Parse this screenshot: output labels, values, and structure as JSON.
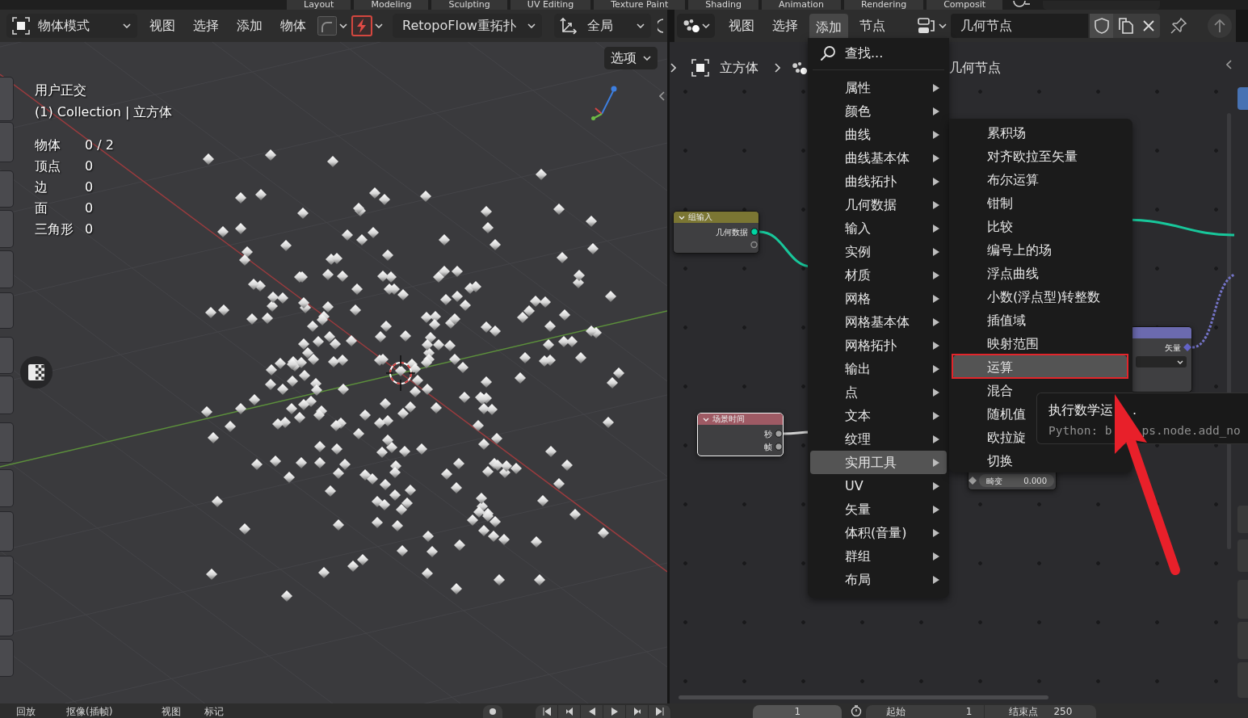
{
  "workspace_tabs": [
    {
      "label": "Layout",
      "selected": false
    },
    {
      "label": "Modeling",
      "selected": false
    },
    {
      "label": "Sculpting",
      "selected": false
    },
    {
      "label": "UV Editing",
      "selected": false
    },
    {
      "label": "Texture Paint",
      "selected": false
    },
    {
      "label": "Shading",
      "selected": false
    },
    {
      "label": "Animation",
      "selected": false
    },
    {
      "label": "Rendering",
      "selected": false
    },
    {
      "label": "Composit",
      "selected": false
    }
  ],
  "viewport": {
    "header": {
      "mode": "物体模式",
      "menus": [
        "视图",
        "选择",
        "添加",
        "物体"
      ],
      "retopo_menu": "RetopoFlow重拓扑",
      "orientation": "全局"
    },
    "options_button": "选项",
    "view_name": "用户正交",
    "collection_info": "(1) Collection | 立方体",
    "stats": [
      {
        "label": "物体",
        "value": "0 / 2"
      },
      {
        "label": "顶点",
        "value": "0"
      },
      {
        "label": "边",
        "value": "0"
      },
      {
        "label": "面",
        "value": "0"
      },
      {
        "label": "三角形",
        "value": "0"
      }
    ]
  },
  "node_editor": {
    "header": {
      "menus": [
        {
          "label": "视图",
          "selected": false
        },
        {
          "label": "选择",
          "selected": false
        },
        {
          "label": "添加",
          "selected": true
        },
        {
          "label": "节点",
          "selected": false
        }
      ],
      "node_group": "几何节点"
    },
    "breadcrumbs": [
      "立方体",
      "几何节点"
    ],
    "nodes": [
      {
        "kind": "group_input",
        "title": "组输入",
        "color": "#7b7633",
        "selected": false,
        "outputs": [
          "几何数据"
        ]
      },
      {
        "kind": "scene_time",
        "title": "场景时间",
        "color": "#9e5a64",
        "selected": true,
        "outputs": [
          "秒",
          "帧"
        ]
      },
      {
        "kind": "vector_node",
        "color": "#6b6aaf",
        "selected": false,
        "outputs": [
          "矢量"
        ]
      },
      {
        "kind": "field_row",
        "label": "畸变",
        "value": "0.000"
      }
    ],
    "sidebar_tabs": [
      {
        "selected": true
      },
      {
        "selected": false
      },
      {
        "selected": false
      },
      {
        "selected": false
      },
      {
        "selected": false
      },
      {
        "selected": false
      }
    ]
  },
  "add_menu": {
    "search": "查找...",
    "items": [
      {
        "label": "属性",
        "selected": false
      },
      {
        "label": "颜色",
        "selected": false
      },
      {
        "label": "曲线",
        "selected": false
      },
      {
        "label": "曲线基本体",
        "selected": false
      },
      {
        "label": "曲线拓扑",
        "selected": false
      },
      {
        "label": "几何数据",
        "selected": false
      },
      {
        "label": "输入",
        "selected": false
      },
      {
        "label": "实例",
        "selected": false
      },
      {
        "label": "材质",
        "selected": false
      },
      {
        "label": "网格",
        "selected": false
      },
      {
        "label": "网格基本体",
        "selected": false
      },
      {
        "label": "网格拓扑",
        "selected": false
      },
      {
        "label": "输出",
        "selected": false
      },
      {
        "label": "点",
        "selected": false
      },
      {
        "label": "文本",
        "selected": false
      },
      {
        "label": "纹理",
        "selected": false
      },
      {
        "label": "实用工具",
        "selected": true
      },
      {
        "label": "UV",
        "selected": false
      },
      {
        "label": "矢量",
        "selected": false
      },
      {
        "label": "体积(音量)",
        "selected": false
      },
      {
        "label": "群组",
        "selected": false
      },
      {
        "label": "布局",
        "selected": false
      }
    ]
  },
  "utilities_submenu": {
    "items": [
      {
        "label": "累积场",
        "selected": false
      },
      {
        "label": "对齐欧拉至矢量",
        "selected": false
      },
      {
        "label": "布尔运算",
        "selected": false
      },
      {
        "label": "钳制",
        "selected": false
      },
      {
        "label": "比较",
        "selected": false
      },
      {
        "label": "编号上的场",
        "selected": false
      },
      {
        "label": "浮点曲线",
        "selected": false
      },
      {
        "label": "小数(浮点型)转整数",
        "selected": false
      },
      {
        "label": "插值域",
        "selected": false
      },
      {
        "label": "映射范围",
        "selected": false
      },
      {
        "label": "运算",
        "selected": true
      },
      {
        "label": "混合",
        "selected": false
      },
      {
        "label": "随机值",
        "selected": false
      },
      {
        "label": "欧拉旋",
        "selected": false
      },
      {
        "label": "切换",
        "selected": false
      }
    ]
  },
  "tooltip": {
    "description": [
      "执行数学运",
      "."
    ],
    "python": [
      "Python: b",
      "ps.node.add_no"
    ]
  },
  "timeline": {
    "menus": [
      "回放",
      "抠像(插帧)",
      "视图",
      "标记"
    ],
    "current_frame": "1",
    "start_label": "起始",
    "start": "1",
    "end_label": "结束点",
    "end": "250"
  }
}
